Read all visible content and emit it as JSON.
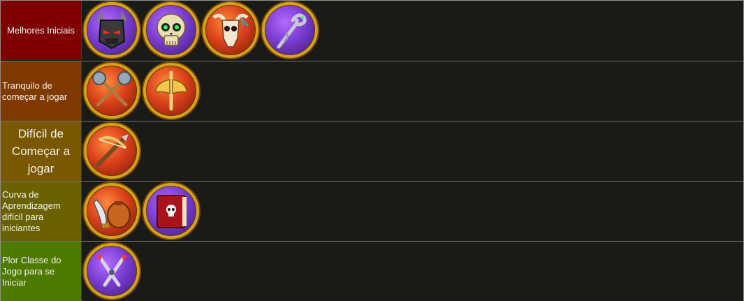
{
  "tiers": [
    {
      "label": "Melhores Iniciais",
      "color": "#7f0000",
      "icons": [
        {
          "name": "horned-helmet-icon",
          "bg": "purple"
        },
        {
          "name": "skull-icon",
          "bg": "purple"
        },
        {
          "name": "ram-skull-icon",
          "bg": "red"
        },
        {
          "name": "serpent-staff-icon",
          "bg": "purple"
        }
      ]
    },
    {
      "label": "Tranquilo de começar a jogar",
      "color": "#803a00",
      "icons": [
        {
          "name": "crossed-maces-icon",
          "bg": "red"
        },
        {
          "name": "double-axe-icon",
          "bg": "red"
        }
      ]
    },
    {
      "label": "Difícil de Começar a jogar",
      "color": "#7a5800",
      "icons": [
        {
          "name": "crossbow-icon",
          "bg": "red"
        }
      ]
    },
    {
      "label": "Curva de Aprendizagem difícil para iniciantes",
      "color": "#6a6200",
      "icons": [
        {
          "name": "dagger-and-bag-icon",
          "bg": "red"
        },
        {
          "name": "skull-tome-icon",
          "bg": "purple"
        }
      ]
    },
    {
      "label": "Plor Classe do Jogo para se Iniciar",
      "color": "#4f7a00",
      "icons": [
        {
          "name": "crossed-claws-icon",
          "bg": "purple"
        }
      ]
    }
  ]
}
